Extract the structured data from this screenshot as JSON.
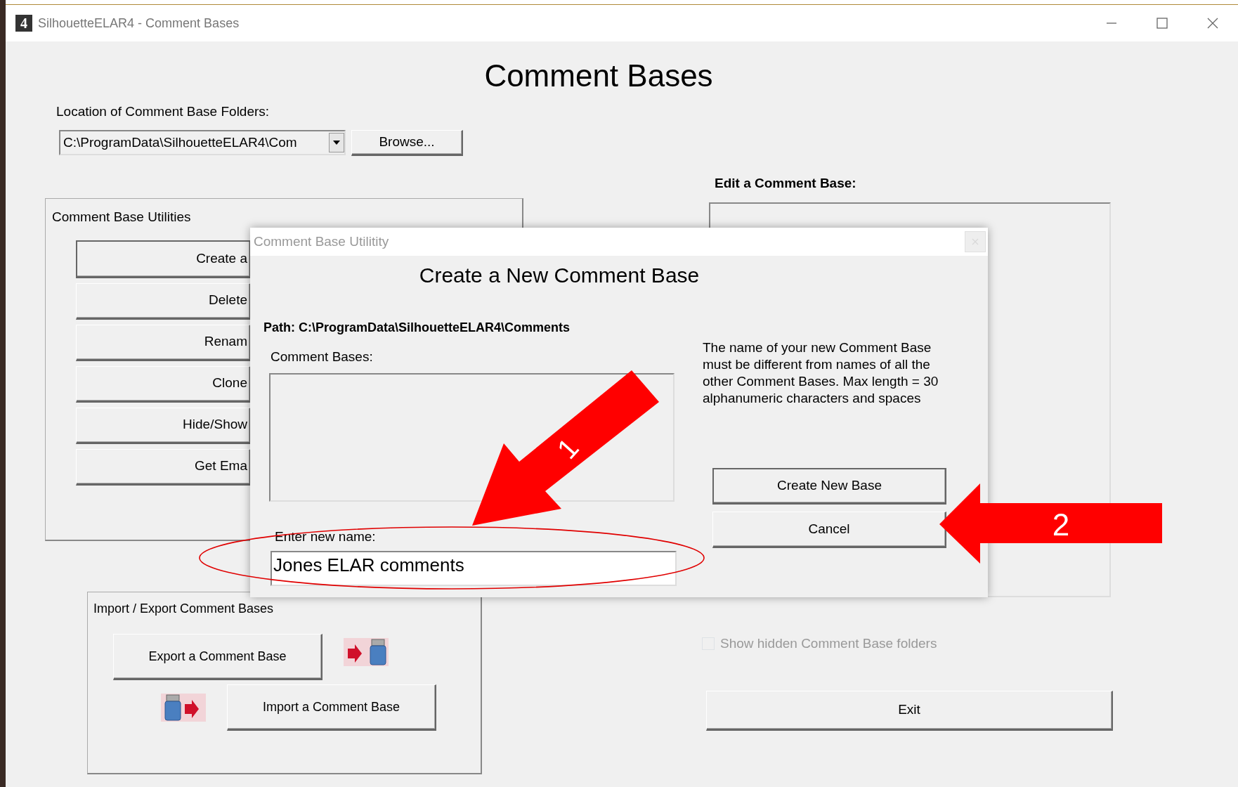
{
  "window": {
    "app_icon": "4",
    "title": "SilhouetteELAR4 - Comment Bases"
  },
  "heading": "Comment Bases",
  "location": {
    "label": "Location of Comment Base Folders:",
    "value": "C:\\ProgramData\\SilhouetteELAR4\\Com",
    "browse_button": "Browse..."
  },
  "utilities": {
    "title": "Comment Base Utilities",
    "buttons": [
      "Create a",
      "Delete",
      "Renam",
      "Clone",
      "Hide/Show",
      "Get Ema"
    ]
  },
  "import_export": {
    "title": "Import / Export Comment Bases",
    "buttons": [
      {
        "kind": "export",
        "label": "Export a Comment Base"
      },
      {
        "kind": "import",
        "label": "Import a Comment Base"
      }
    ]
  },
  "edit": {
    "label": "Edit a Comment Base:"
  },
  "show_hidden": {
    "label": "Show hidden Comment Base folders",
    "checked": false,
    "disabled": true
  },
  "exit_button": "Exit",
  "dialog": {
    "title": "Comment Base Utilitity",
    "heading": "Create a New Comment Base",
    "path": "Path: C:\\ProgramData\\SilhouetteELAR4\\Comments",
    "list_label": "Comment Bases:",
    "note": "The name of your new Comment Base must be different from names of all the other Comment Bases. Max length = 30 alphanumeric characters and spaces",
    "name_label": "Enter new name:",
    "name_value": "Jones ELAR comments",
    "buttons": [
      "Create New Base",
      "Cancel"
    ]
  },
  "annotations": [
    {
      "kind": "ellipse"
    },
    {
      "kind": "arrow-down-left",
      "label": "1"
    },
    {
      "kind": "arrow-left",
      "label": "2"
    }
  ]
}
